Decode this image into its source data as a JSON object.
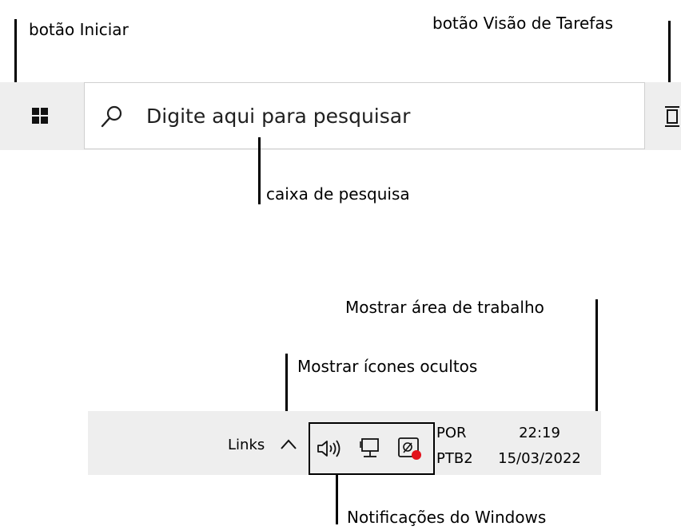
{
  "annotations": {
    "start": "botão Iniciar",
    "task_view": "botão Visão de Tarefas",
    "search_box": "caixa de pesquisa",
    "show_desktop": "Mostrar área de trabalho",
    "hidden_icons": "Mostrar ícones ocultos",
    "notifications": "Notificações do Windows"
  },
  "taskbar": {
    "search_placeholder": "Digite aqui para pesquisar",
    "start_icon": "windows-logo-icon",
    "search_icon": "search-icon",
    "task_view_icon": "task-view-icon"
  },
  "tray": {
    "links_label": "Links",
    "chevron_icon": "chevron-up-icon",
    "icons": [
      "speaker-icon",
      "network-icon",
      "notification-app-icon"
    ],
    "language": "POR",
    "keyboard_layout": "PTB2",
    "time": "22:19",
    "date": "15/03/2022",
    "badge_color": "#e3121c"
  },
  "colors": {
    "taskbar_bg": "#eeeeee",
    "search_bg": "#ffffff"
  }
}
